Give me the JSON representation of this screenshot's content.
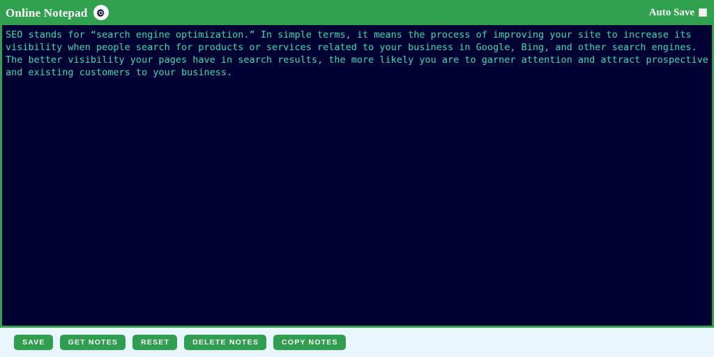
{
  "header": {
    "brand_title": "Online Notepad",
    "gear_icon": "gear-icon",
    "autosave_label": "Auto Save",
    "autosave_checked": false
  },
  "editor": {
    "content": "SEO stands for “search engine optimization.” In simple terms, it means the process of improving your site to increase its visibility when people search for products or services related to your business in Google, Bing, and other search engines. The better visibility your pages have in search results, the more likely you are to garner attention and attract prospective and existing customers to your business.",
    "placeholder": "",
    "text_color": "#2ee0b0",
    "background_color": "#000033"
  },
  "toolbar": {
    "buttons": [
      {
        "label": "Save",
        "name": "save-button"
      },
      {
        "label": "Get Notes",
        "name": "get-notes-button"
      },
      {
        "label": "Reset",
        "name": "reset-button"
      },
      {
        "label": "Delete Notes",
        "name": "delete-notes-button"
      },
      {
        "label": "Copy Notes",
        "name": "copy-notes-button"
      }
    ]
  },
  "theme": {
    "header_green": "#30a14e",
    "button_green": "#2f9e4f",
    "footer_background": "#eaf6fd",
    "editor_navy": "#000033",
    "editor_text": "#2ee0b0"
  }
}
